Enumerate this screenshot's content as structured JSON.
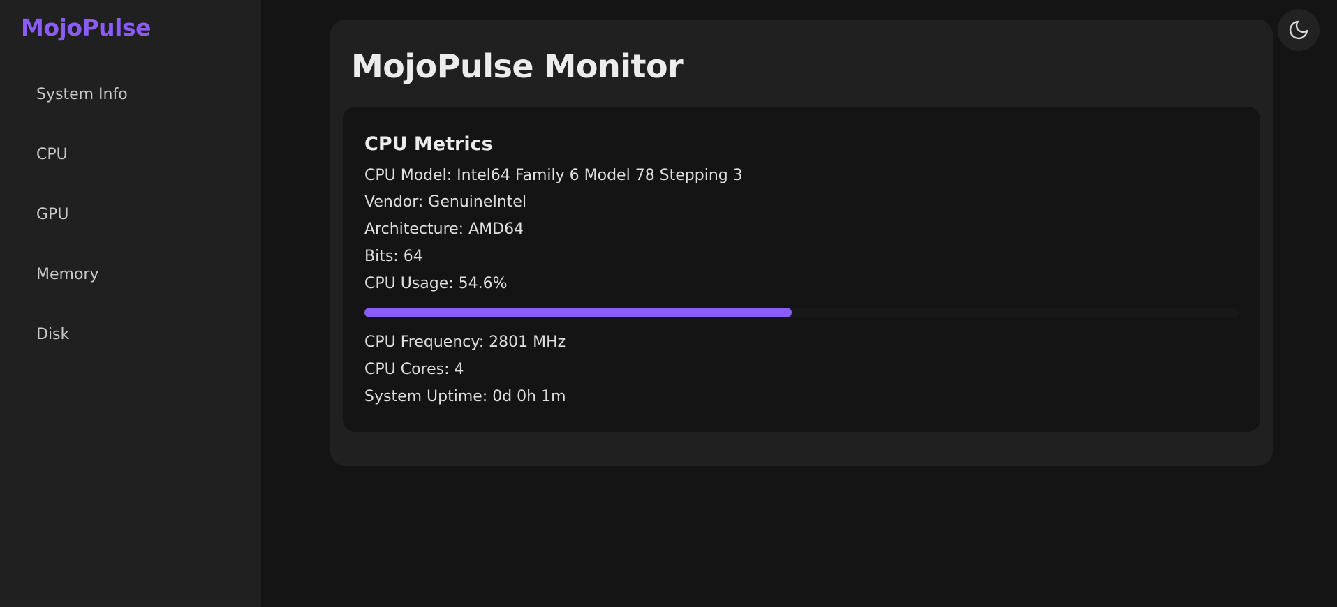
{
  "sidebar": {
    "brand": "MojoPulse",
    "items": [
      {
        "label": "System Info"
      },
      {
        "label": "CPU"
      },
      {
        "label": "GPU"
      },
      {
        "label": "Memory"
      },
      {
        "label": "Disk"
      }
    ]
  },
  "main": {
    "title": "MojoPulse Monitor",
    "cpu_metrics": {
      "heading": "CPU Metrics",
      "cpu_model": "CPU Model: Intel64 Family 6 Model 78 Stepping 3",
      "vendor": "Vendor: GenuineIntel",
      "architecture": "Architecture: AMD64",
      "bits": "Bits: 64",
      "cpu_usage": "CPU Usage: 54.6%",
      "cpu_usage_percent": 54.6,
      "cpu_frequency": "CPU Frequency: 2801 MHz",
      "cpu_cores": "CPU Cores: 4",
      "system_uptime": "System Uptime: 0d 0h 1m"
    }
  },
  "theme_toggle": {
    "icon": "moon-icon"
  },
  "colors": {
    "accent": "#8b5cf6",
    "background": "#141414",
    "surface": "#202020"
  }
}
